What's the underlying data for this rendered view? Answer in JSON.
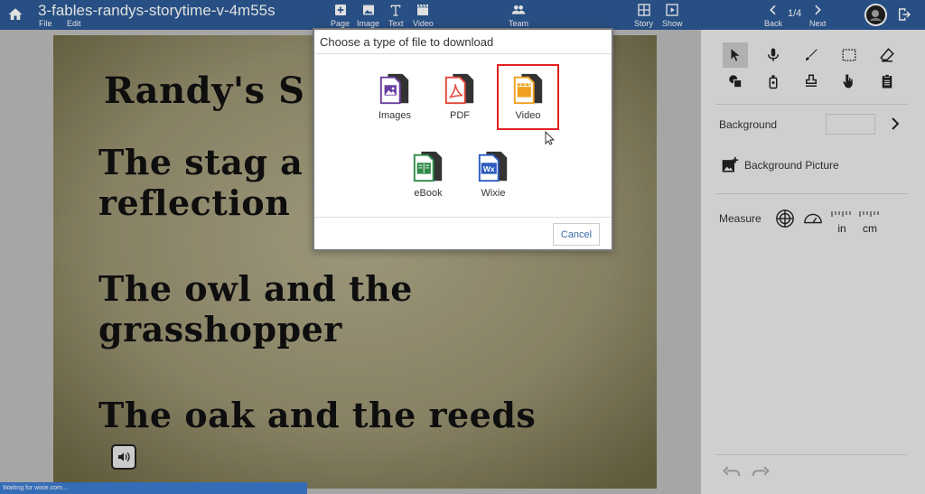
{
  "header": {
    "title": "3-fables-randys-storytime-v-4m55s",
    "menu_file": "File",
    "menu_edit": "Edit",
    "insert": {
      "page": "Page",
      "image": "Image",
      "text": "Text",
      "video": "Video"
    },
    "team": "Team",
    "story": "Story",
    "show": "Show",
    "back": "Back",
    "next": "Next",
    "page_indicator": "1/4"
  },
  "canvas": {
    "title_line": "Randy's S",
    "stag_line1": "The stag a",
    "stag_line2": "reflection",
    "owl_line1": "The owl and the",
    "owl_line2": "grasshopper",
    "oak_line": "The oak and the reeds"
  },
  "right_panel": {
    "background_label": "Background",
    "background_picture_label": "Background Picture",
    "measure_label": "Measure",
    "unit_in": "in",
    "unit_cm": "cm"
  },
  "dialog": {
    "title": "Choose a type of file to download",
    "options": [
      {
        "label": "Images",
        "icon": "images-file-icon",
        "color": "#6b3fa0"
      },
      {
        "label": "PDF",
        "icon": "pdf-file-icon",
        "color": "#e0473a"
      },
      {
        "label": "Video",
        "icon": "video-file-icon",
        "color": "#f0a020"
      },
      {
        "label": "eBook",
        "icon": "ebook-file-icon",
        "color": "#2e8b4a"
      },
      {
        "label": "Wixie",
        "icon": "wixie-file-icon",
        "color": "#2a5bbf"
      }
    ],
    "selected": "Video",
    "cancel_label": "Cancel"
  },
  "status": {
    "text": "Waiting for wixie.com..."
  },
  "colors": {
    "topbar": "#2d5a96",
    "accent_selected": "#e02020"
  }
}
